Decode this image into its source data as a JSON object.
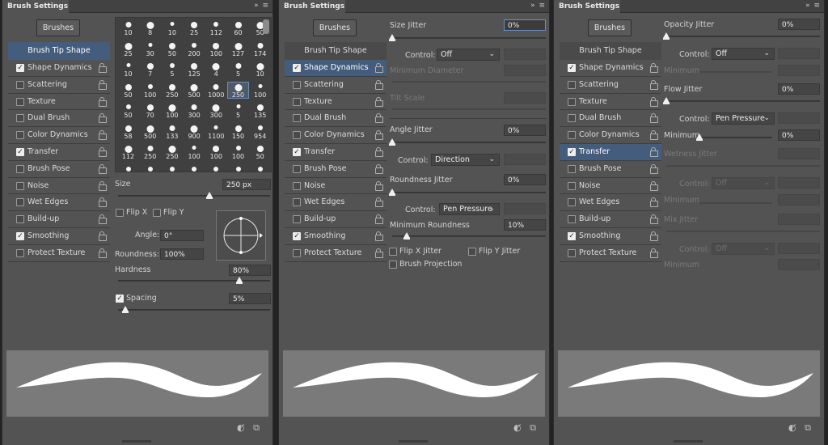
{
  "panels": [
    {
      "tab_title": "Brush Settings",
      "brushes_button": "Brushes"
    },
    {
      "tab_title": "Brush Settings",
      "brushes_button": "Brushes"
    },
    {
      "tab_title": "Brush Settings",
      "brushes_button": "Brushes"
    }
  ],
  "categories": {
    "header": "Brush Tip Shape",
    "items": [
      {
        "label": "Shape Dynamics",
        "checked": true
      },
      {
        "label": "Scattering",
        "checked": false
      },
      {
        "label": "Texture",
        "checked": false
      },
      {
        "label": "Dual Brush",
        "checked": false
      },
      {
        "label": "Color Dynamics",
        "checked": false
      },
      {
        "label": "Transfer",
        "checked": true
      },
      {
        "label": "Brush Pose",
        "checked": false
      },
      {
        "label": "Noise",
        "checked": false
      },
      {
        "label": "Wet Edges",
        "checked": false
      },
      {
        "label": "Build-up",
        "checked": false
      },
      {
        "label": "Smoothing",
        "checked": true
      },
      {
        "label": "Protect Texture",
        "checked": false
      }
    ]
  },
  "tip_grid": [
    [
      "10",
      "8",
      "10",
      "25",
      "112",
      "60",
      "50"
    ],
    [
      "25",
      "30",
      "50",
      "200",
      "100",
      "127",
      "174"
    ],
    [
      "10",
      "7",
      "5",
      "125",
      "4",
      "5",
      "10"
    ],
    [
      "50",
      "100",
      "250",
      "500",
      "1000",
      "250",
      "100"
    ],
    [
      "50",
      "70",
      "100",
      "300",
      "300",
      "5",
      "135"
    ],
    [
      "58",
      "500",
      "133",
      "900",
      "1100",
      "150",
      "954"
    ],
    [
      "112",
      "250",
      "250",
      "100",
      "100",
      "100",
      "50"
    ]
  ],
  "tip_shape": {
    "size_label": "Size",
    "size_value": "250 px",
    "flip_x": "Flip X",
    "flip_y": "Flip Y",
    "angle_label": "Angle:",
    "angle_value": "0°",
    "roundness_label": "Roundness:",
    "roundness_value": "100%",
    "hardness_label": "Hardness",
    "hardness_value": "80%",
    "spacing_label": "Spacing",
    "spacing_value": "5%",
    "size_fraction": 0.6,
    "hardness_fraction": 0.8,
    "spacing_fraction": 0.05
  },
  "shape_dynamics": {
    "size_jitter_label": "Size Jitter",
    "size_jitter_value": "0%",
    "control_label": "Control:",
    "control1_value": "Off",
    "min_diameter_label": "Minimum Diameter",
    "tilt_scale_label": "Tilt Scale",
    "angle_jitter_label": "Angle Jitter",
    "angle_jitter_value": "0%",
    "control2_value": "Direction",
    "roundness_jitter_label": "Roundness Jitter",
    "roundness_jitter_value": "0%",
    "control3_value": "Pen Pressure",
    "min_roundness_label": "Minimum Roundness",
    "min_roundness_value": "10%",
    "flip_x_jitter": "Flip X Jitter",
    "flip_y_jitter": "Flip Y Jitter",
    "brush_projection": "Brush Projection"
  },
  "transfer": {
    "opacity_jitter_label": "Opacity Jitter",
    "opacity_jitter_value": "0%",
    "control_label": "Control:",
    "control1_value": "Off",
    "minimum_label": "Minimum",
    "flow_jitter_label": "Flow Jitter",
    "flow_jitter_value": "0%",
    "control2_value": "Pen Pressure",
    "minimum2_value": "0%",
    "wetness_jitter_label": "Wetness Jitter",
    "control3_value": "Off",
    "mix_jitter_label": "Mix Jitter",
    "control4_value": "Off"
  },
  "icons": [
    "panel-expand-icon",
    "panel-menu-icon",
    "lock-icon",
    "toggle-preview-icon",
    "new-brush-icon"
  ],
  "colors": {
    "selected_row": "#455d7d",
    "panel_bg": "#535353",
    "preview_bg": "#7a7a7a"
  }
}
